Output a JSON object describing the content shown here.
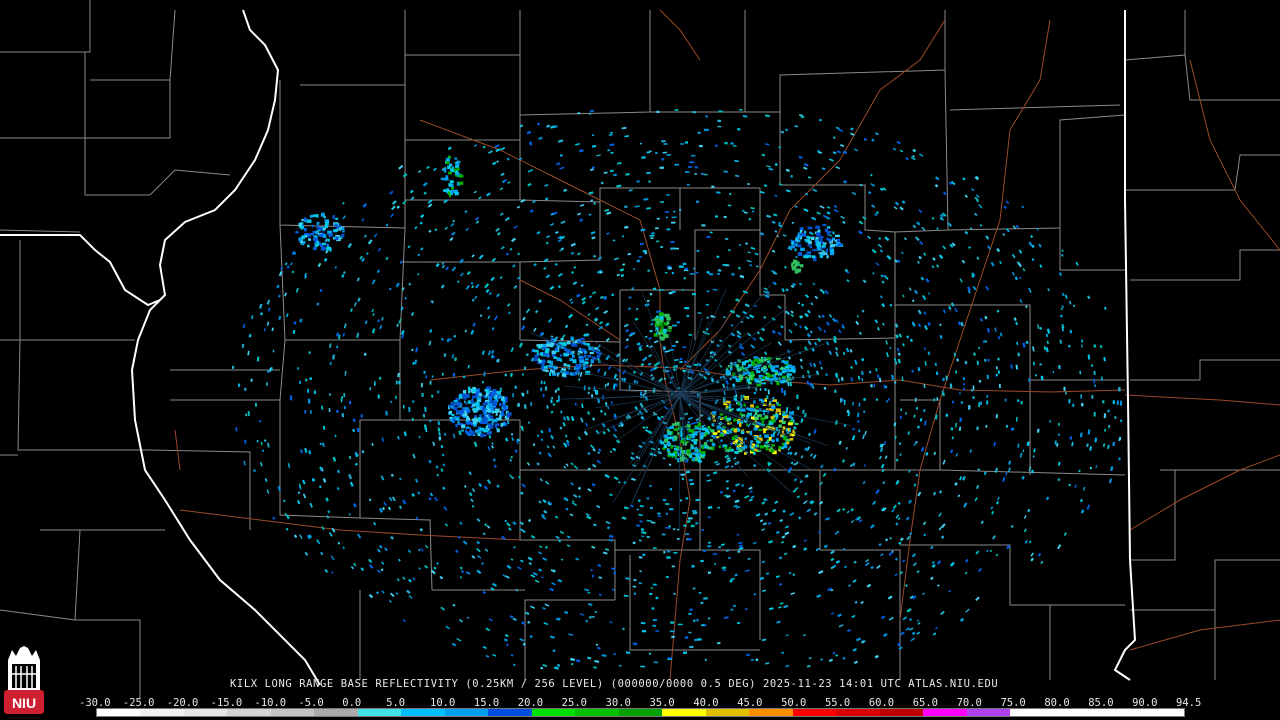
{
  "title": "KILX LONG RANGE BASE REFLECTIVITY (0.25KM / 256 LEVEL) (000000/0000 0.5 DEG) 2025-11-23 14:01 UTC  ATLAS.NIU.EDU",
  "logo": {
    "text": "NIU",
    "icon": "niu-tower-icon",
    "colors": {
      "red": "#cc1f2f",
      "white": "#ffffff"
    }
  },
  "colors": {
    "background": "#000000",
    "county_lines": "#8a8a8a",
    "state_lines": "#ffffff",
    "highways": "#9a4a2a"
  },
  "radar": {
    "site": "KILX",
    "product": "LONG RANGE BASE REFLECTIVITY",
    "date": "2025-11-23",
    "time": "14:01 UTC"
  },
  "scale": {
    "labels": [
      "-30.0",
      "-25.0",
      "-20.0",
      "-15.0",
      "-10.0",
      "-5.0",
      "0.0",
      "5.0",
      "10.0",
      "15.0",
      "20.0",
      "25.0",
      "30.0",
      "35.0",
      "40.0",
      "45.0",
      "50.0",
      "55.0",
      "60.0",
      "65.0",
      "70.0",
      "75.0",
      "80.0",
      "85.0",
      "90.0",
      "94.5"
    ],
    "colors": [
      "#ffffff",
      "#f2f2f2",
      "#e6e6e6",
      "#d4d4d4",
      "#c4c4c4",
      "#aaaaaa",
      "#40e0e8",
      "#00c0ff",
      "#00a0f0",
      "#0050e0",
      "#00e000",
      "#00c000",
      "#00a000",
      "#ffff00",
      "#e0c000",
      "#ff9000",
      "#ff0000",
      "#d80000",
      "#c00000",
      "#ff00ff",
      "#b040f0",
      "#ffffff",
      "#ffffff",
      "#ffffff",
      "#ffffff"
    ]
  }
}
